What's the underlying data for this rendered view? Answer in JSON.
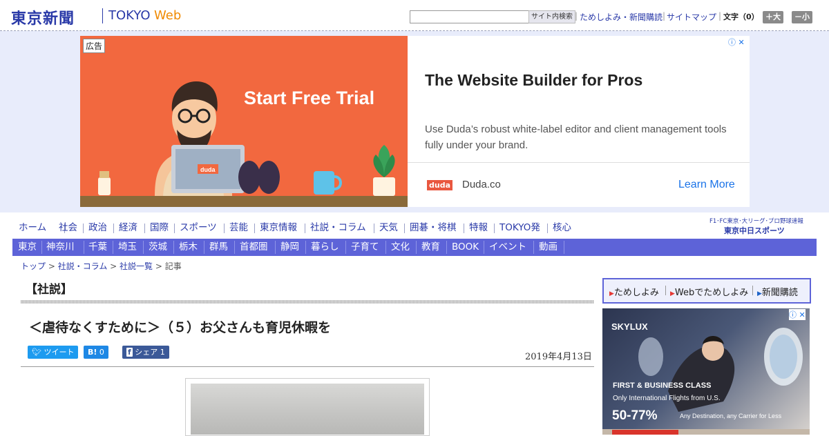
{
  "header": {
    "logo_ja": "東京新聞",
    "logo_en_tokyo": "TOKYO",
    "logo_en_web": "Web",
    "search_placeholder": "",
    "search_button": "サイト内検索",
    "links": [
      "ためしよみ・新聞購読",
      "サイトマップ"
    ],
    "font_size_label": "文字（0）",
    "font_larger": "＋大",
    "font_smaller": "－小"
  },
  "ad_top": {
    "label": "広告",
    "cta": "Start Free Trial",
    "laptop_brand": "duda",
    "headline": "The Website Builder for Pros",
    "description": "Use Duda’s robust white-label editor and client management tools fully under your brand.",
    "brand_logo": "duda",
    "brand_name": "Duda.co",
    "more": "Learn More",
    "adchoices": "ⓘ ✕",
    "colors": {
      "image_bg": "#f2683f",
      "cta_link": "#1a73e8"
    }
  },
  "nav": {
    "main": [
      "ホーム",
      "社会",
      "政治",
      "経済",
      "国際",
      "スポーツ",
      "芸能",
      "東京情報",
      "社説・コラム",
      "天気",
      "囲碁・将棋",
      "特報",
      "TOKYO発",
      "核心"
    ],
    "chunichi_top": "F1･FC東京･大リーグ･プロ野球速報",
    "chunichi_logo": "東京中日スポーツ",
    "region": [
      "東京",
      "神奈川",
      "千葉",
      "埼玉",
      "茨城",
      "栃木",
      "群馬",
      "首都圏",
      "静岡",
      "暮らし",
      "子育て",
      "文化",
      "教育",
      "BOOK",
      "イベント",
      "動画"
    ],
    "colors": {
      "link": "#2a3aa8",
      "region_bg": "#5d63d8"
    }
  },
  "breadcrumb": {
    "items": [
      "トップ",
      "社説・コラム",
      "社説一覧"
    ],
    "current": "記事",
    "separator": " > "
  },
  "article": {
    "section": "【社説】",
    "title": "＜虐待なくすために＞（５）お父さんも育児休暇を",
    "tweet": "ツイート",
    "hatena_count": "0",
    "fb_share": "シェア",
    "fb_count": "1",
    "date": "2019年4月13日"
  },
  "sidebar": {
    "links": [
      "ためしよみ",
      "Webでためしよみ",
      "新聞購読"
    ],
    "ad": {
      "logo": "SKYLUX",
      "line1": "FIRST & BUSINESS CLASS",
      "line2": "Only International Flights from U.S.",
      "percent": "50-77%",
      "note": "Any Destination, any Carrier for Less",
      "adchoices": "ⓘ ✕"
    }
  }
}
